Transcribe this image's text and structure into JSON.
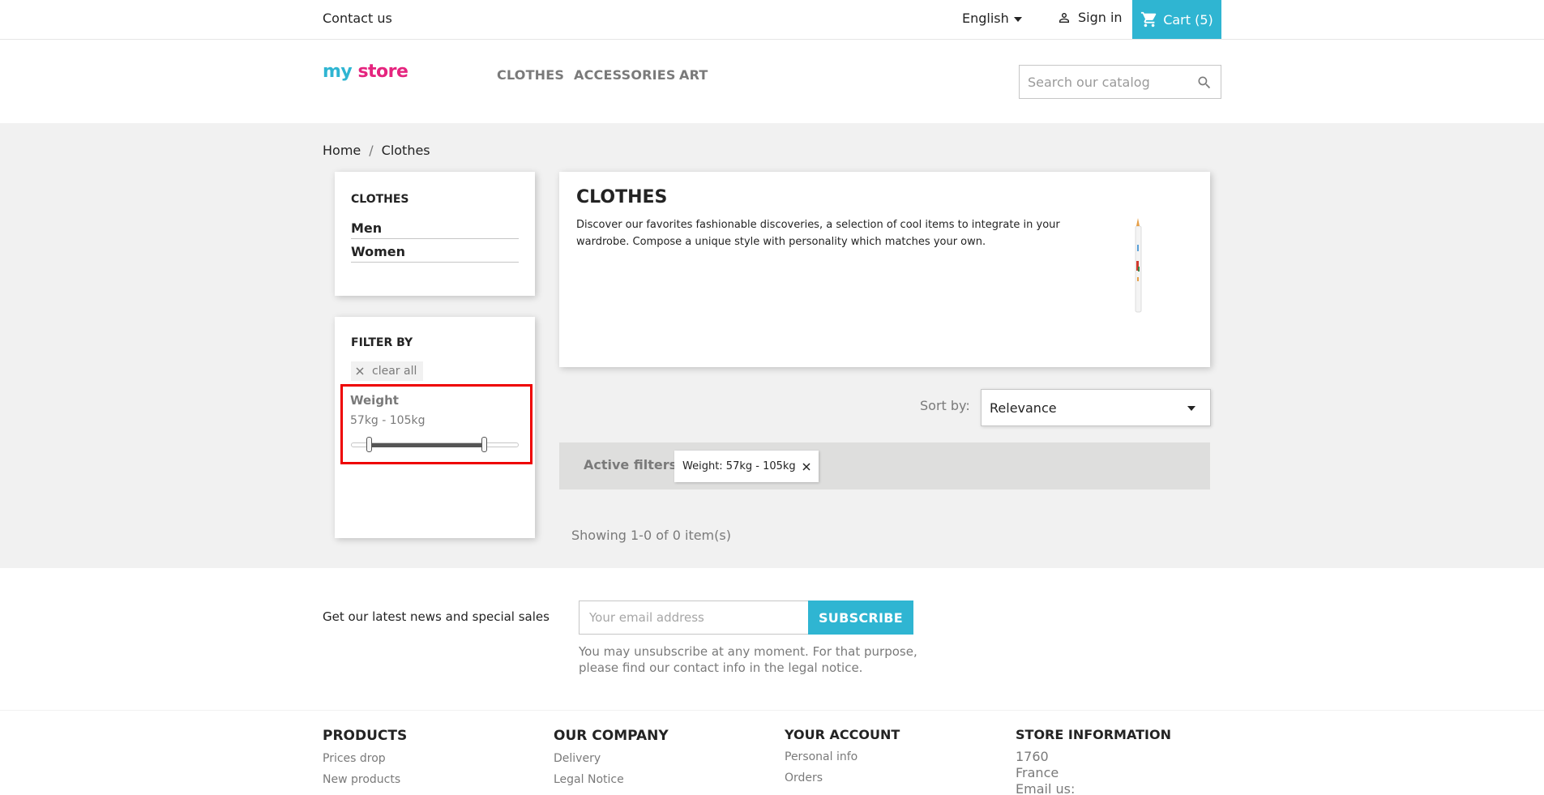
{
  "topbar": {
    "contact": "Contact us",
    "language": "English",
    "sign_in": "Sign in",
    "cart": "Cart (5)"
  },
  "header": {
    "logo": {
      "text1": "my",
      "text2": "store"
    },
    "menu": [
      "CLOTHES",
      "ACCESSORIES",
      "ART"
    ],
    "search_placeholder": "Search our catalog"
  },
  "breadcrumb": {
    "items": [
      "Home",
      "Clothes"
    ],
    "separator": "/"
  },
  "sidebar": {
    "category_title": "CLOTHES",
    "subcategories": [
      "Men",
      "Women"
    ],
    "filter_title": "FILTER BY",
    "clear_all": "clear all",
    "weight": {
      "title": "Weight",
      "range_label": "57kg - 105kg",
      "min": 57,
      "max": 105
    }
  },
  "category": {
    "title": "CLOTHES",
    "description": "Discover our favorites fashionable discoveries, a selection of cool items to integrate in your wardrobe. Compose a unique style with personality which matches your own."
  },
  "sort": {
    "label": "Sort by:",
    "selected": "Relevance"
  },
  "active_filters": {
    "label": "Active filters",
    "chip": "Weight: 57kg - 105kg"
  },
  "results": {
    "showing": "Showing 1-0 of 0 item(s)"
  },
  "newsletter": {
    "text": "Get our latest news and special sales",
    "placeholder": "Your email address",
    "button": "SUBSCRIBE",
    "note": "You may unsubscribe at any moment. For that purpose, please find our contact info in the legal notice."
  },
  "footer": {
    "products": {
      "title": "PRODUCTS",
      "links": [
        "Prices drop",
        "New products"
      ]
    },
    "company": {
      "title": "OUR COMPANY",
      "links": [
        "Delivery",
        "Legal Notice"
      ]
    },
    "account": {
      "title": "YOUR ACCOUNT",
      "links": [
        "Personal info",
        "Orders"
      ]
    },
    "store": {
      "title": "STORE INFORMATION",
      "lines": [
        "1760",
        "France",
        "Email us:"
      ]
    }
  },
  "colors": {
    "accent": "#2fb5d2",
    "highlight": "#e00000"
  }
}
